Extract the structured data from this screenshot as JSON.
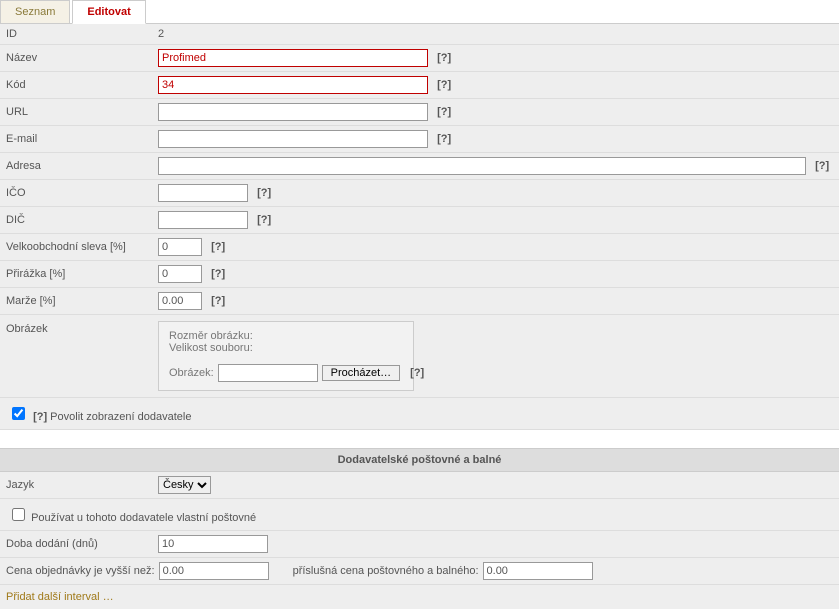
{
  "tabs": {
    "list": "Seznam",
    "edit": "Editovat"
  },
  "fields": {
    "id": {
      "label": "ID",
      "value": "2"
    },
    "name": {
      "label": "Název",
      "value": "Profimed"
    },
    "code": {
      "label": "Kód",
      "value": "34"
    },
    "url": {
      "label": "URL",
      "value": ""
    },
    "email": {
      "label": "E-mail",
      "value": ""
    },
    "address": {
      "label": "Adresa",
      "value": ""
    },
    "ico": {
      "label": "IČO",
      "value": ""
    },
    "dic": {
      "label": "DIČ",
      "value": ""
    },
    "wholesale": {
      "label": "Velkoobchodní sleva [%]",
      "value": "0"
    },
    "surcharge": {
      "label": "Přirážka [%]",
      "value": "0"
    },
    "margin": {
      "label": "Marže [%]",
      "value": "0.00"
    },
    "image": {
      "label": "Obrázek"
    }
  },
  "help": "[?]",
  "image_panel": {
    "dim": "Rozměr obrázku:",
    "size": "Velikost souboru:",
    "lbl": "Obrázek:",
    "browse": "Procházet…"
  },
  "allow_display": "Povolit zobrazení dodavatele",
  "shipping": {
    "title": "Dodavatelské poštovné a balné",
    "lang_label": "Jazyk",
    "lang_value": "Česky",
    "use_own": "Používat u tohoto dodavatele vlastní poštovné",
    "delivery_label": "Doba dodání (dnů)",
    "delivery_value": "10",
    "order_gt": "Cena objednávky je vyšší než:",
    "order_gt_value": "0.00",
    "ship_price": "příslušná cena poštovného a balného:",
    "ship_price_value": "0.00",
    "add": "Přidat další interval …"
  }
}
